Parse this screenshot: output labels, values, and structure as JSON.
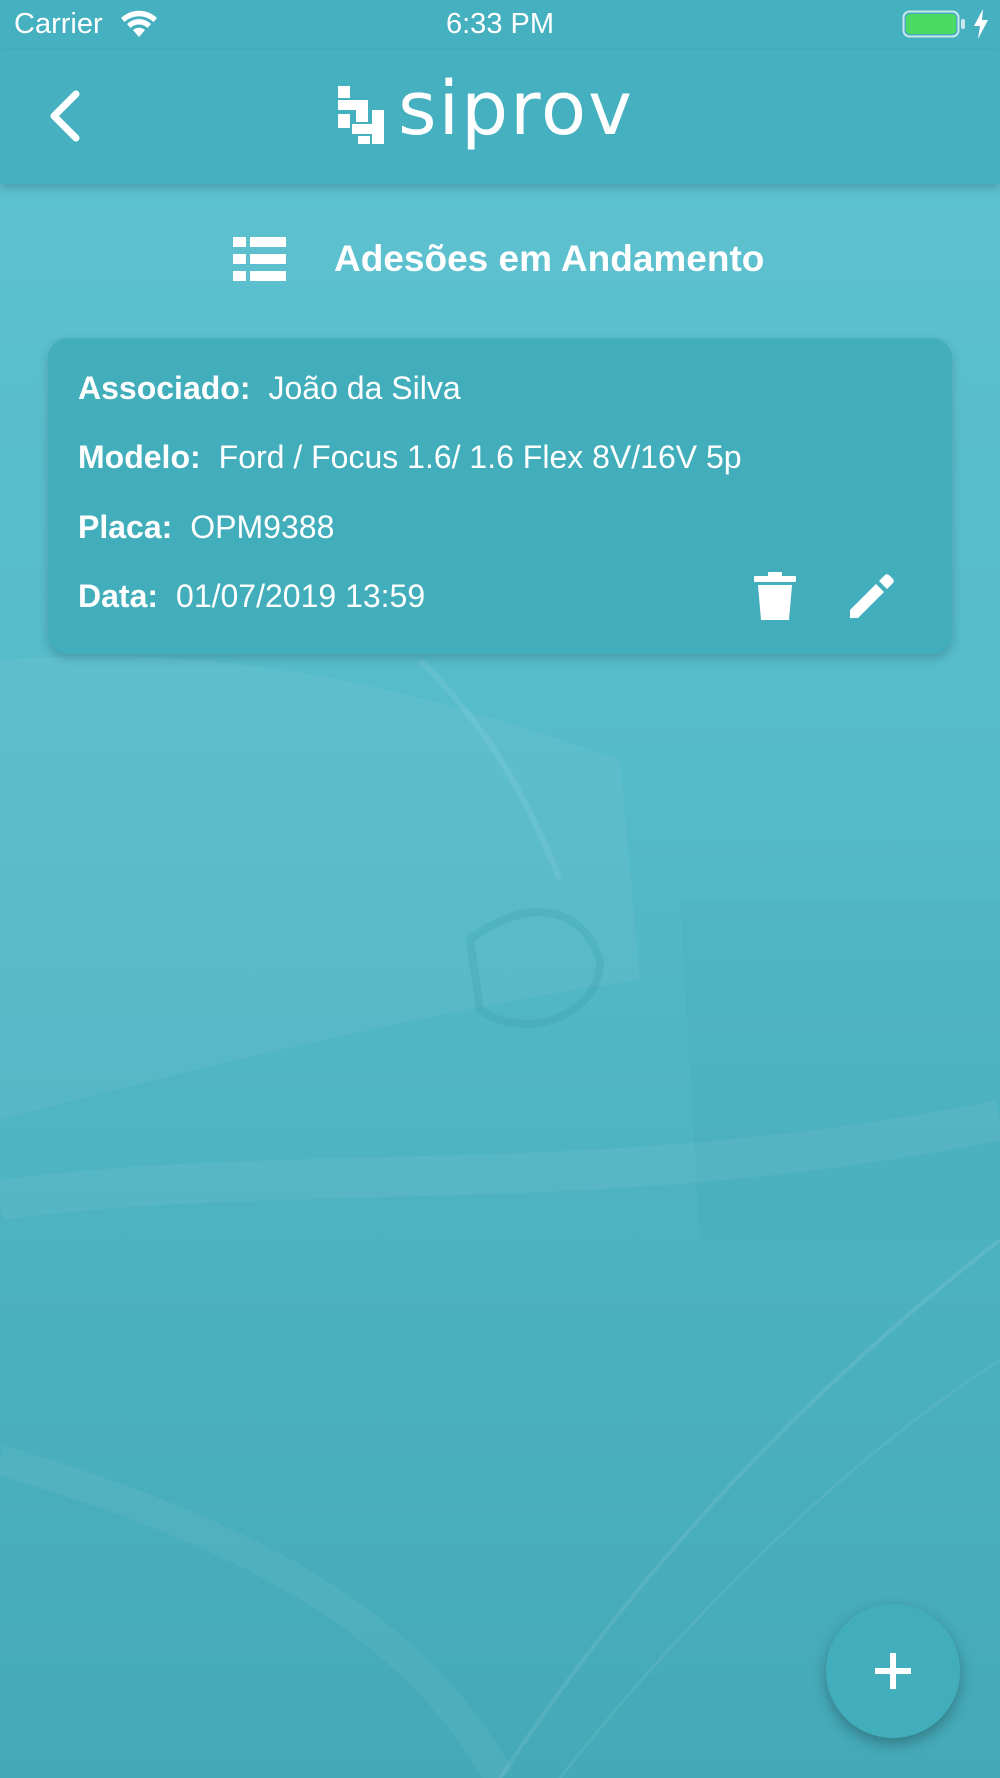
{
  "status_bar": {
    "carrier": "Carrier",
    "time": "6:33 PM",
    "icons": [
      "wifi-icon",
      "battery-icon",
      "charging-icon"
    ]
  },
  "nav": {
    "back_icon": "chevron-left-icon",
    "logo_text": "siprov"
  },
  "section": {
    "icon": "list-icon",
    "title": "Adesões em Andamento"
  },
  "card": {
    "associado_label": "Associado:",
    "associado_value": "João da Silva",
    "modelo_label": "Modelo:",
    "modelo_value": "Ford / Focus 1.6/ 1.6 Flex 8V/16V 5p",
    "placa_label": "Placa:",
    "placa_value": "OPM9388",
    "data_label": "Data:",
    "data_value": "01/07/2019 13:59",
    "actions": [
      "trash-icon",
      "edit-icon"
    ]
  },
  "fab": {
    "icon": "plus-icon"
  },
  "colors": {
    "bar": "#45b0bf",
    "card": "#43aebb",
    "background": "#56bbca",
    "battery": "#4cd964"
  }
}
